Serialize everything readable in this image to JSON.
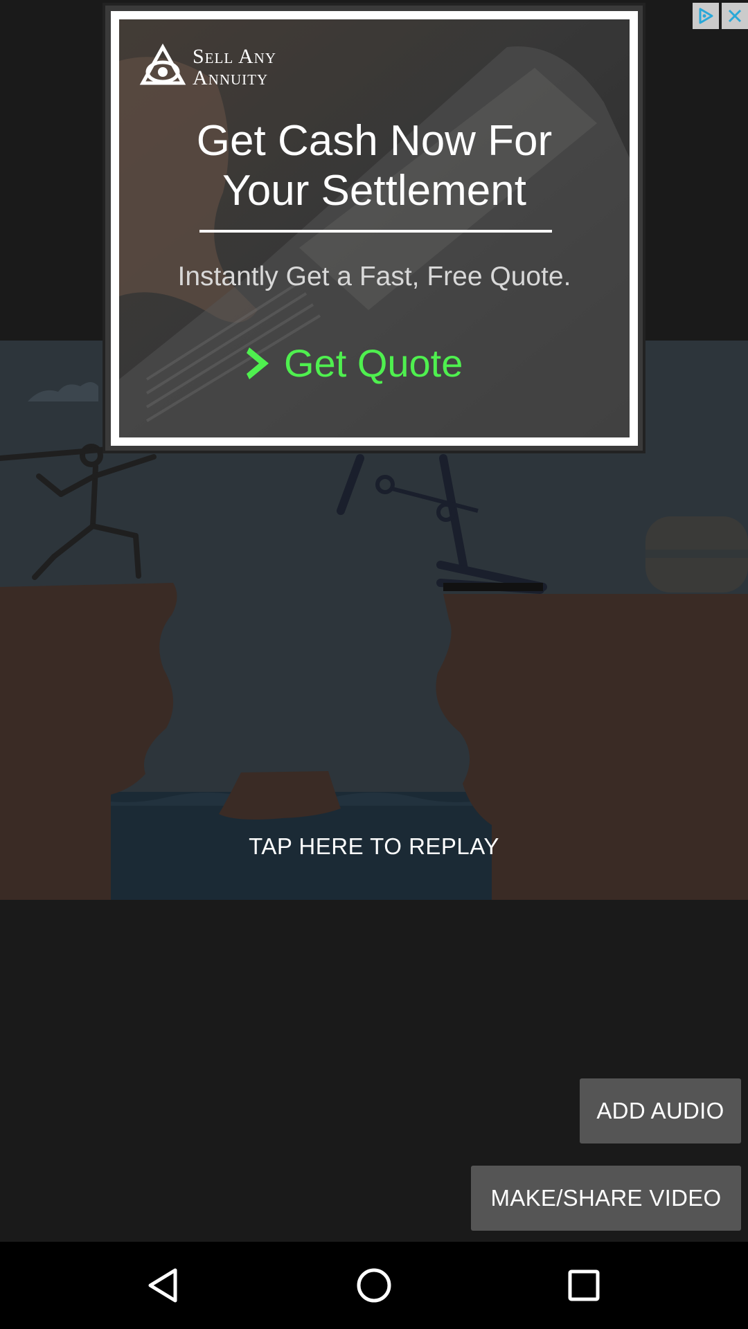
{
  "ad": {
    "brand_line1": "Sell Any",
    "brand_line2": "Annuity",
    "headline_line1": "Get Cash Now For",
    "headline_line2": "Your Settlement",
    "subline": "Instantly Get a Fast, Free Quote.",
    "cta_label": "Get Quote",
    "cta_color": "#4ff04f",
    "choices_icon": "adchoices-icon",
    "close_icon": "close-icon"
  },
  "scene": {
    "replay_label": "TAP HERE TO REPLAY"
  },
  "actions": {
    "add_audio_label": "ADD AUDIO",
    "make_share_label": "MAKE/SHARE VIDEO"
  },
  "navbar": {
    "back_icon": "back-triangle-icon",
    "home_icon": "home-circle-icon",
    "recents_icon": "recents-square-icon"
  }
}
